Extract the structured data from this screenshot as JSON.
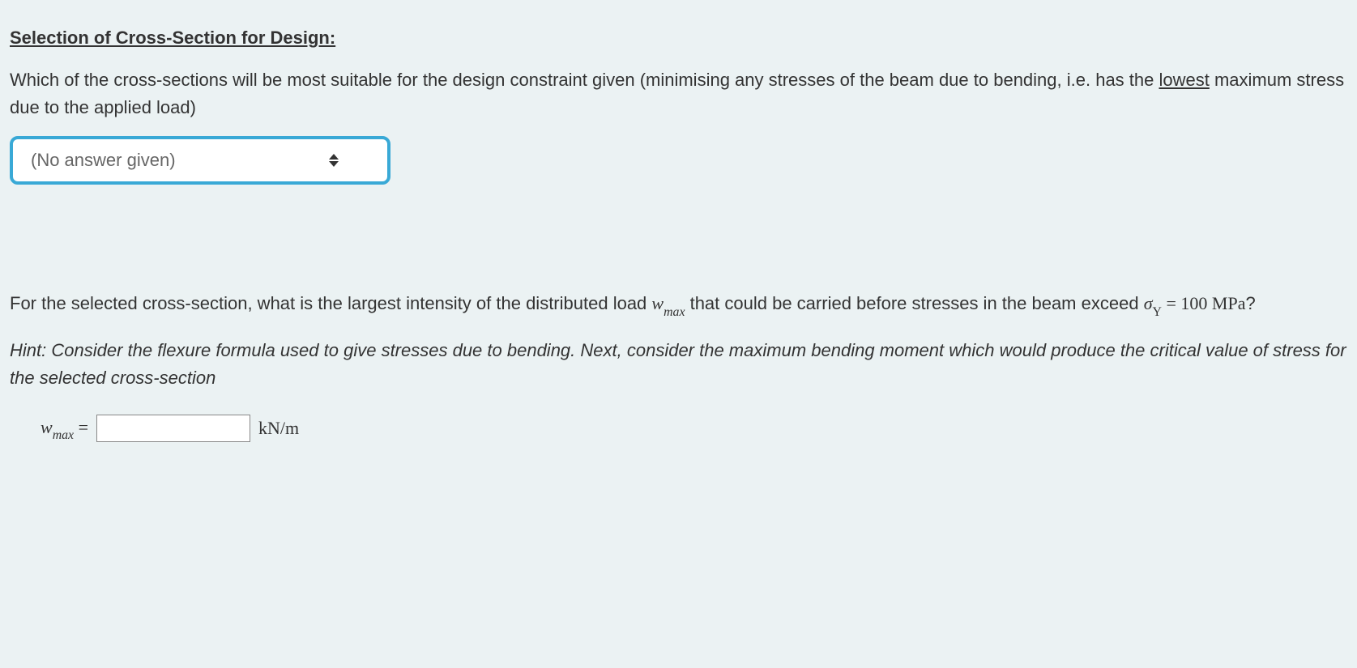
{
  "heading": "Selection of Cross-Section for Design:",
  "q1_part1": "Which of the cross-sections will be most suitable for the design constraint given (minimising any stresses of the beam due to bending, i.e. has the ",
  "q1_lowest": "lowest",
  "q1_part2": " maximum stress due to the applied load)",
  "select_placeholder": "(No answer given)",
  "q2_part1": "For the selected cross-section, what is the largest intensity of the distributed load ",
  "q2_wmax_var": "w",
  "q2_wmax_sub": "max",
  "q2_part2": " that could be carried before stresses in the beam exceed ",
  "q2_sigma": "σ",
  "q2_sigma_sub": "Y",
  "q2_eq": " = 100 MPa",
  "q2_qmark": "?",
  "hint": "Hint: Consider the flexure formula used to give stresses due to bending. Next, consider the maximum bending moment which would produce the critical value of stress for the selected cross-section",
  "answer_var": "w",
  "answer_sub": "max",
  "answer_eq": " = ",
  "answer_unit": "kN/m"
}
